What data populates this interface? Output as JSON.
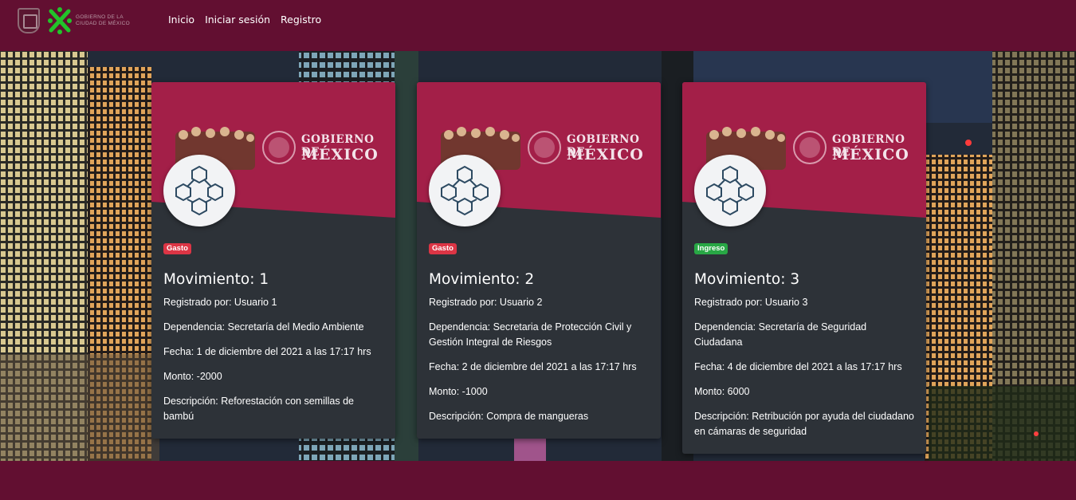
{
  "nav": {
    "logo_text": "GOBIERNO DE LA CIUDAD DE MÉXICO",
    "links": [
      "Inicio",
      "Iniciar sesión",
      "Registro"
    ]
  },
  "banner": {
    "line1": "GOBIERNO DE",
    "line2": "MÉXICO"
  },
  "colors": {
    "brand": "#620f31",
    "banner": "#a31f48",
    "card": "#2d3238",
    "gasto": "#dc3545",
    "ingreso": "#28a745"
  },
  "cards": [
    {
      "badge": "Gasto",
      "title": "Movimiento: 1",
      "registrado": "Registrado por: Usuario 1",
      "dependencia": "Dependencia: Secretaría del Medio Ambiente",
      "fecha": "Fecha: 1 de diciembre del 2021 a las 17:17 hrs",
      "monto": "Monto: -2000",
      "descripcion": "Descripción: Reforestación con semillas de bambú",
      "icon": "blockchain-icon"
    },
    {
      "badge": "Gasto",
      "title": "Movimiento: 2",
      "registrado": "Registrado por: Usuario 2",
      "dependencia": "Dependencia: Secretaria de Protección Civil y Gestión Integral de Riesgos",
      "fecha": "Fecha: 2 de diciembre del 2021 a las 17:17 hrs",
      "monto": "Monto: -1000",
      "descripcion": "Descripción: Compra de mangueras",
      "icon": "blockchain-icon"
    },
    {
      "badge": "Ingreso",
      "title": "Movimiento: 3",
      "registrado": "Registrado por: Usuario 3",
      "dependencia": "Dependencia: Secretaría de Seguridad Ciudadana",
      "fecha": "Fecha: 4 de diciembre del 2021 a las 17:17 hrs",
      "monto": "Monto: 6000",
      "descripcion": "Descripción: Retribución por ayuda del ciudadano en cámaras de seguridad",
      "icon": "blockchain-icon"
    }
  ]
}
